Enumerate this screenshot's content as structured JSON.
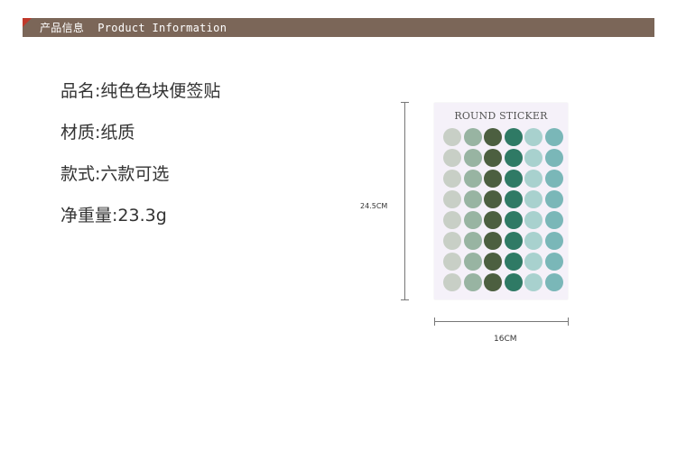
{
  "header": {
    "title": "产品信息  Product Information",
    "bar_color": "#7b6658",
    "accent_color": "#c0392b"
  },
  "info": {
    "lines": [
      "品名:纯色色块便签贴",
      "材质:纸质",
      "款式:六款可选",
      "净重量:23.3g"
    ]
  },
  "sticker_sheet": {
    "title": "ROUND STICKER",
    "rows": 8,
    "column_colors": [
      "#c8cfc6",
      "#98b4a2",
      "#4c5f40",
      "#2f7a65",
      "#a8d1ce",
      "#7ab7b8"
    ]
  },
  "dimensions": {
    "height_label": "24.5CM",
    "width_label": "16CM"
  }
}
